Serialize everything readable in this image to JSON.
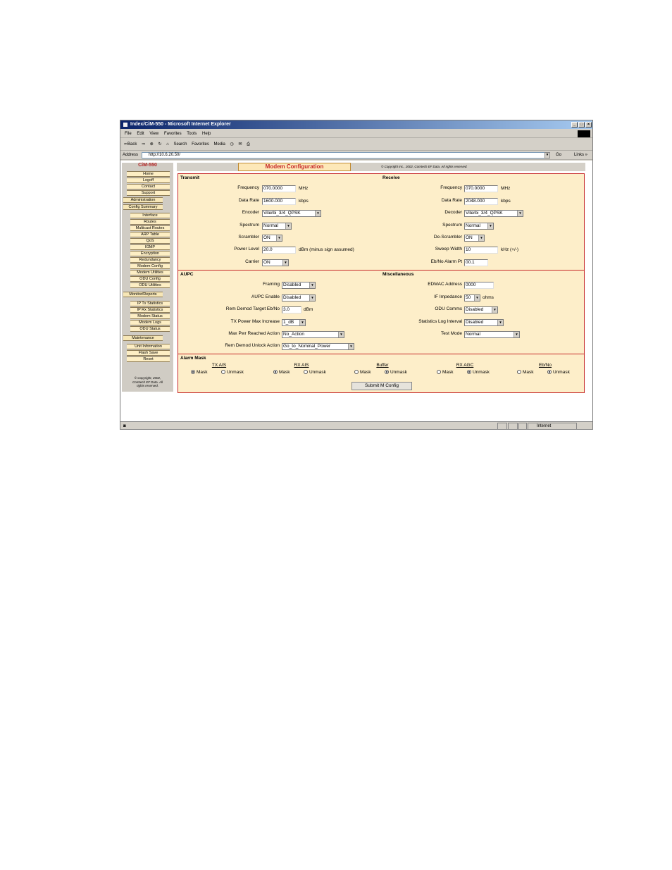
{
  "window": {
    "title": "Index/CiM-550 - Microsoft Internet Explorer",
    "controls": [
      "_",
      "□",
      "×"
    ]
  },
  "menu": [
    "File",
    "Edit",
    "View",
    "Favorites",
    "Tools",
    "Help"
  ],
  "toolbar": {
    "back": "⇐Back",
    "forward": "⇒",
    "search": "Search",
    "favorites": "Favorites",
    "media": "Media"
  },
  "address": {
    "label": "Address",
    "url": "http://10.6.20.50/",
    "go": "Go",
    "links": "Links »"
  },
  "status": {
    "zone": "Internet"
  },
  "sidebar": {
    "brand": "CiM-550",
    "items": [
      "Home",
      "Logoff",
      "Contact",
      "Support",
      "Administration",
      "Config Summary",
      "Interface",
      "Routes",
      "Multicast Routes",
      "ARP Table",
      "QoS",
      "IGMP",
      "Encryption",
      "Redundancy",
      "Modem Config",
      "Modem Utilities",
      "ODU Config",
      "ODU Utilities",
      "Monitor/Reports",
      "IP Tx Statistics",
      "IP Rx Statistics",
      "Modem Status",
      "Modem Logs",
      "ODU Status",
      "Maintenance",
      "Unit Information",
      "Flash Save",
      "Reset"
    ],
    "copyright": [
      "© Copyright, 2002,",
      "Comtech EF Data. All",
      "rights reserved."
    ]
  },
  "header": {
    "title": "Modem Configuration",
    "copyright": "© Copyright Inc., 2002, Comtech EF Data. All rights reserved."
  },
  "transmit": {
    "title": "Transmit",
    "frequency_label": "Frequency",
    "frequency": "070.0000",
    "frequency_unit": "MHz",
    "datarate_label": "Data Rate",
    "datarate": "1600.000",
    "datarate_unit": "kbps",
    "encoder_label": "Encoder",
    "encoder": "Viterbi_3/4_QPSK",
    "spectrum_label": "Spectrum",
    "spectrum": "Normal",
    "scrambler_label": "Scrambler",
    "scrambler": "ON",
    "power_label": "Power Level",
    "power": "20.0",
    "power_unit": "dBm (minus sign assumed)",
    "carrier_label": "Carrier",
    "carrier": "ON"
  },
  "receive": {
    "title": "Receive",
    "frequency_label": "Frequency",
    "frequency": "070.0000",
    "frequency_unit": "MHz",
    "datarate_label": "Data Rate",
    "datarate": "2048.000",
    "datarate_unit": "kbps",
    "decoder_label": "Decoder",
    "decoder": "Viterbi_3/4_QPSK",
    "spectrum_label": "Spectrum",
    "spectrum": "Normal",
    "descrambler_label": "De-Scrambler",
    "descrambler": "ON",
    "sweep_label": "Sweep Width",
    "sweep": "10",
    "sweep_unit": "kHz (+/-)",
    "ebno_label": "Eb/No Alarm Pt",
    "ebno": "00.1"
  },
  "aupc": {
    "title": "AUPC",
    "framing_label": "Framing",
    "framing": "Disabled",
    "enable_label": "AUPC Enable",
    "enable": "Disabled",
    "target_label": "Rem Demod Target Eb/No",
    "target": "3.0",
    "target_unit": "dBm",
    "maxinc_label": "TX Power Max Increase",
    "maxinc": "1_dB",
    "maxpwr_label": "Max Pwr Reached Action",
    "maxpwr": "No_Action",
    "unlock_label": "Rem Demod Unlock Action",
    "unlock": "Go_to_Nominal_Power"
  },
  "misc": {
    "title": "Miscellaneous",
    "edmac_label": "EDMAC Address",
    "edmac": "0000",
    "impedance_label": "IF Impedance",
    "impedance": "50",
    "impedance_unit": "ohms",
    "odu_label": "ODU Comms",
    "odu": "Disabled",
    "statlog_label": "Statistics Log Interval",
    "statlog": "Disabled",
    "testmode_label": "Test Mode",
    "testmode": "Normal"
  },
  "alarm": {
    "title": "Alarm Mask",
    "mask_label": "Mask",
    "unmask_label": "Unmask",
    "groups": [
      {
        "name": "TX AIS",
        "selected": "Mask"
      },
      {
        "name": "RX AIS",
        "selected": "Mask"
      },
      {
        "name": "Buffer",
        "selected": "Unmask"
      },
      {
        "name": "RX AGC",
        "selected": "Unmask"
      },
      {
        "name": "Eb/No",
        "selected": "Unmask"
      }
    ],
    "submit": "Submit M Config"
  }
}
